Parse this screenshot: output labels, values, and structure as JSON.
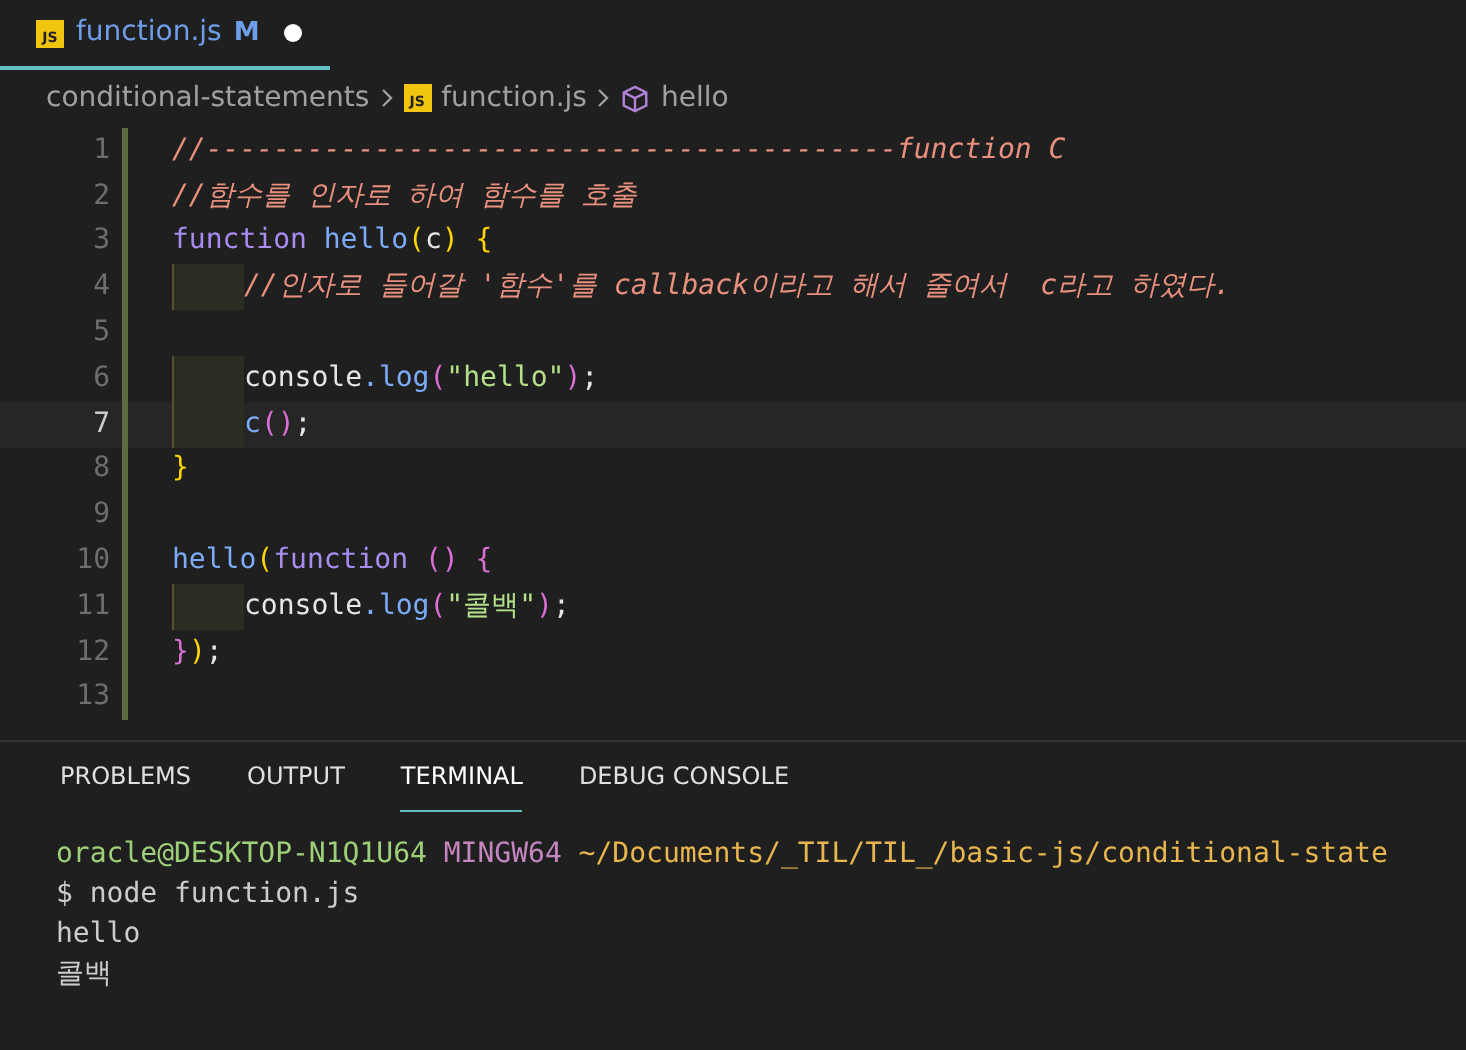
{
  "tab": {
    "icon_label": "JS",
    "title": "function.js",
    "badge": "M",
    "modified": true,
    "selected": true
  },
  "breadcrumb": [
    {
      "kind": "folder",
      "label": "conditional-statements"
    },
    {
      "kind": "file",
      "label": "function.js",
      "icon_label": "JS"
    },
    {
      "kind": "symbol",
      "label": "hello"
    }
  ],
  "editor": {
    "lines": [
      {
        "number": "1",
        "current": false,
        "tokens": [
          {
            "kind": "comment",
            "text": "//-----------------------------------------function C"
          }
        ]
      },
      {
        "number": "2",
        "current": false,
        "tokens": [
          {
            "kind": "comment",
            "text": "//함수를 인자로 하여 함수를 호출"
          }
        ]
      },
      {
        "number": "3",
        "current": false,
        "tokens": [
          {
            "kind": "keyword",
            "text": "function "
          },
          {
            "kind": "func",
            "text": "hello"
          },
          {
            "kind": "bracket",
            "text": "("
          },
          {
            "kind": "plain",
            "text": "c"
          },
          {
            "kind": "bracket",
            "text": ") {"
          }
        ]
      },
      {
        "number": "4",
        "current": false,
        "indented": true,
        "tokens": [
          {
            "kind": "comment",
            "text": "//인자로 들어갈 '함수'를 callback이라고 해서 줄여서  c라고 하였다."
          }
        ]
      },
      {
        "number": "5",
        "current": false,
        "indented": false
      },
      {
        "number": "6",
        "current": false,
        "indented": true,
        "tokens": [
          {
            "kind": "plain",
            "text": "console"
          },
          {
            "kind": "func",
            "text": ".log"
          },
          {
            "kind": "bracket2",
            "text": "("
          },
          {
            "kind": "string",
            "text": "\"hello\""
          },
          {
            "kind": "bracket2",
            "text": ")"
          },
          {
            "kind": "plain",
            "text": ";"
          }
        ]
      },
      {
        "number": "7",
        "current": true,
        "indented": true,
        "tokens": [
          {
            "kind": "func",
            "text": "c"
          },
          {
            "kind": "bracket2",
            "text": "()"
          },
          {
            "kind": "plain",
            "text": ";"
          }
        ]
      },
      {
        "number": "8",
        "current": false,
        "tokens": [
          {
            "kind": "bracket",
            "text": "}"
          }
        ]
      },
      {
        "number": "9",
        "current": false,
        "indented": false
      },
      {
        "number": "10",
        "current": false,
        "tokens": [
          {
            "kind": "func",
            "text": "hello"
          },
          {
            "kind": "bracket",
            "text": "("
          },
          {
            "kind": "keyword",
            "text": "function "
          },
          {
            "kind": "bracket2",
            "text": "() {"
          }
        ]
      },
      {
        "number": "11",
        "current": false,
        "indented": true,
        "tokens": [
          {
            "kind": "plain",
            "text": "console"
          },
          {
            "kind": "func",
            "text": ".log"
          },
          {
            "kind": "bracket2",
            "text": "("
          },
          {
            "kind": "string",
            "text": "\"콜백\""
          },
          {
            "kind": "bracket2",
            "text": ")"
          },
          {
            "kind": "plain",
            "text": ";"
          }
        ]
      },
      {
        "number": "12",
        "current": false,
        "tokens": [
          {
            "kind": "bracket2",
            "text": "}"
          },
          {
            "kind": "bracket",
            "text": ")"
          },
          {
            "kind": "plain",
            "text": ";"
          }
        ]
      },
      {
        "number": "13",
        "current": false,
        "indented": false
      }
    ]
  },
  "panel_tabs": [
    {
      "label": "PROBLEMS",
      "selected": false
    },
    {
      "label": "OUTPUT",
      "selected": false
    },
    {
      "label": "TERMINAL",
      "selected": true
    },
    {
      "label": "DEBUG CONSOLE",
      "selected": false
    }
  ],
  "terminal": [
    [
      {
        "kind": "user",
        "text": "oracle@DESKTOP-N1Q1U64"
      },
      {
        "kind": "host",
        "text": " MINGW64"
      },
      {
        "kind": "path",
        "text": " ~/Documents/_TIL/TIL_/basic-js/conditional-state"
      }
    ],
    [
      {
        "kind": "plain",
        "text": "$ node function.js"
      }
    ],
    [
      {
        "kind": "plain",
        "text": "hello"
      }
    ],
    [
      {
        "kind": "plain",
        "text": "콜백"
      }
    ]
  ]
}
